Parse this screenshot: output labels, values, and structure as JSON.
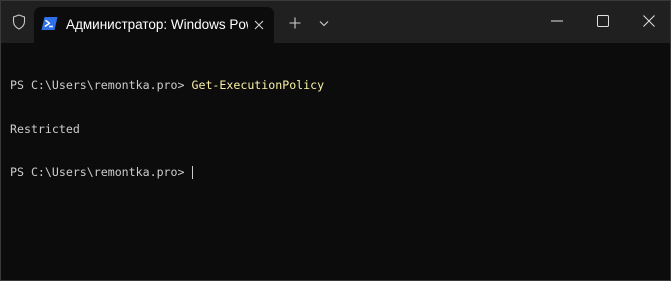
{
  "window": {
    "tab_title": "Администратор: Windows PowerShell",
    "tab_icon": "powershell-icon",
    "admin_icon": "shield-icon",
    "new_tab_icon": "plus-icon",
    "dropdown_icon": "chevron-down-icon",
    "minimize_icon": "minimize-icon",
    "maximize_icon": "maximize-icon",
    "close_icon": "close-icon"
  },
  "terminal": {
    "lines": [
      {
        "prompt": "PS C:\\Users\\remontka.pro> ",
        "command": "Get-ExecutionPolicy"
      },
      {
        "output": "Restricted"
      },
      {
        "prompt": "PS C:\\Users\\remontka.pro> "
      }
    ]
  },
  "colors": {
    "background": "#0c0c0c",
    "titlebar": "#202020",
    "text": "#cccccc",
    "command": "#f9f1a5",
    "powershell_blue": "#1e5ed8"
  }
}
